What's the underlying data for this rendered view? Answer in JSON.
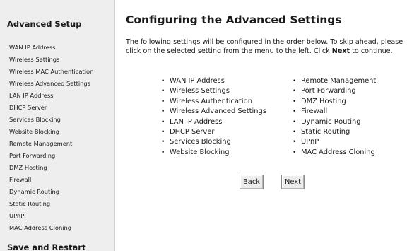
{
  "sidebar": {
    "title": "Advanced Setup",
    "items": [
      {
        "label": "WAN IP Address"
      },
      {
        "label": "Wireless Settings"
      },
      {
        "label": "Wireless MAC Authentication"
      },
      {
        "label": "Wireless Advanced Settings"
      },
      {
        "label": "LAN IP Address"
      },
      {
        "label": "DHCP Server"
      },
      {
        "label": "Services Blocking"
      },
      {
        "label": "Website Blocking"
      },
      {
        "label": "Remote Management"
      },
      {
        "label": "Port Forwarding"
      },
      {
        "label": "DMZ Hosting"
      },
      {
        "label": "Firewall"
      },
      {
        "label": "Dynamic Routing"
      },
      {
        "label": "Static Routing"
      },
      {
        "label": "UPnP"
      },
      {
        "label": "MAC Address Cloning"
      }
    ],
    "footer": "Save and Restart"
  },
  "main": {
    "title": "Configuring the Advanced Settings",
    "intro_before": "The following settings will be configured in the order below. To skip ahead, please click on the selected setting from the menu to the left. Click ",
    "intro_bold": "Next",
    "intro_after": " to continue.",
    "bullet": "•",
    "left_column": [
      {
        "label": "WAN IP Address"
      },
      {
        "label": "Wireless Settings"
      },
      {
        "label": "Wireless Authentication"
      },
      {
        "label": "Wireless Advanced Settings"
      },
      {
        "label": "LAN IP Address"
      },
      {
        "label": "DHCP Server"
      },
      {
        "label": "Services Blocking"
      },
      {
        "label": "Website Blocking"
      }
    ],
    "right_column": [
      {
        "label": "Remote Management"
      },
      {
        "label": "Port Forwarding"
      },
      {
        "label": "DMZ Hosting"
      },
      {
        "label": "Firewall"
      },
      {
        "label": "Dynamic Routing"
      },
      {
        "label": "Static Routing"
      },
      {
        "label": "UPnP"
      },
      {
        "label": "MAC Address Cloning"
      }
    ],
    "back_label": "Back",
    "next_label": "Next"
  }
}
